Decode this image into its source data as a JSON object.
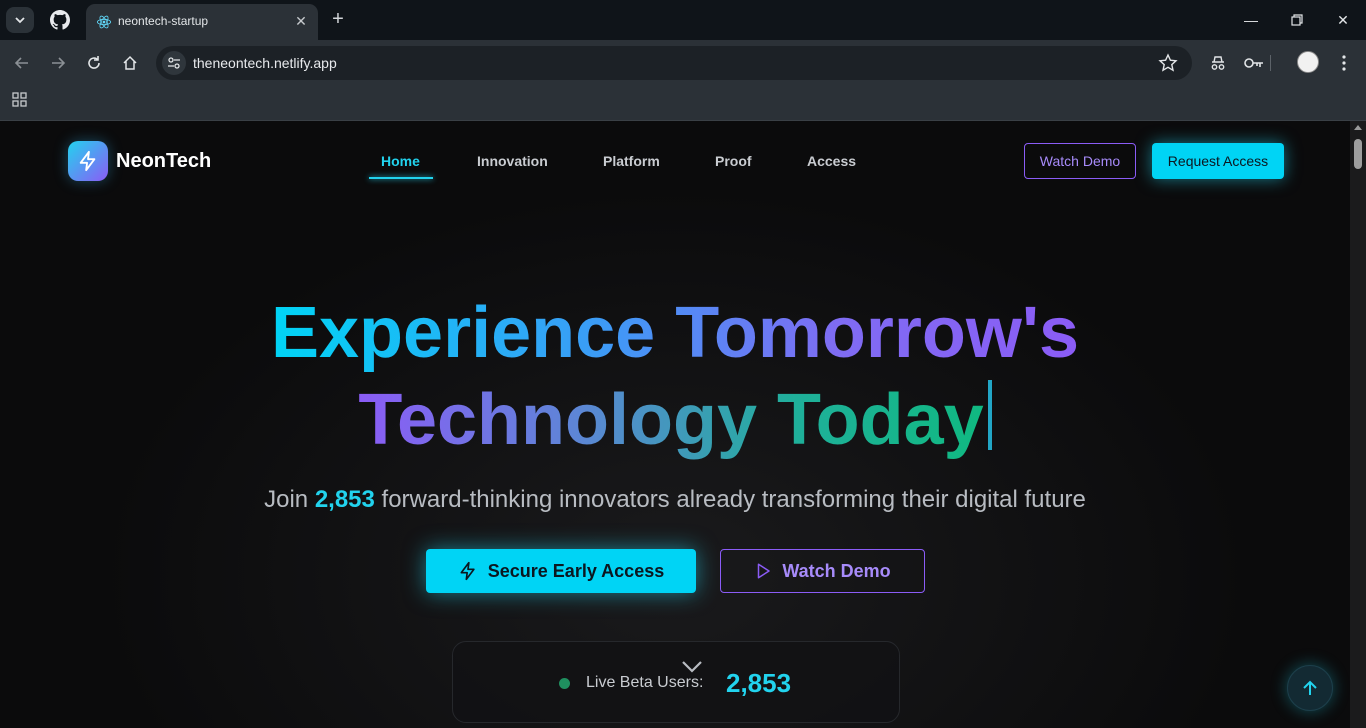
{
  "browser": {
    "tab_title": "neontech-startup",
    "url": "theneontech.netlify.app"
  },
  "nav": {
    "brand": "NeonTech",
    "links": [
      "Home",
      "Innovation",
      "Platform",
      "Proof",
      "Access"
    ],
    "active": "Home",
    "watch_demo": "Watch Demo",
    "request_access": "Request Access"
  },
  "hero": {
    "headline_line1": "Experience Tomorrow's",
    "headline_line2": "Technology Today",
    "sub_prefix": "Join ",
    "sub_count": "2,853",
    "sub_suffix": " forward-thinking innovators already transforming their digital future",
    "cta_primary": "Secure Early Access",
    "cta_secondary": "Watch Demo"
  },
  "stats": {
    "label": "Live Beta Users:",
    "count": "2,853"
  },
  "colors": {
    "accent_cyan": "#00d4f5",
    "accent_purple": "#8b5cf6",
    "accent_green": "#10b981",
    "background": "#0b0b0c"
  },
  "icons": {
    "logo": "lightning-icon",
    "cta_primary": "lightning-icon",
    "cta_secondary": "play-icon",
    "back_to_top": "arrow-up-icon"
  }
}
